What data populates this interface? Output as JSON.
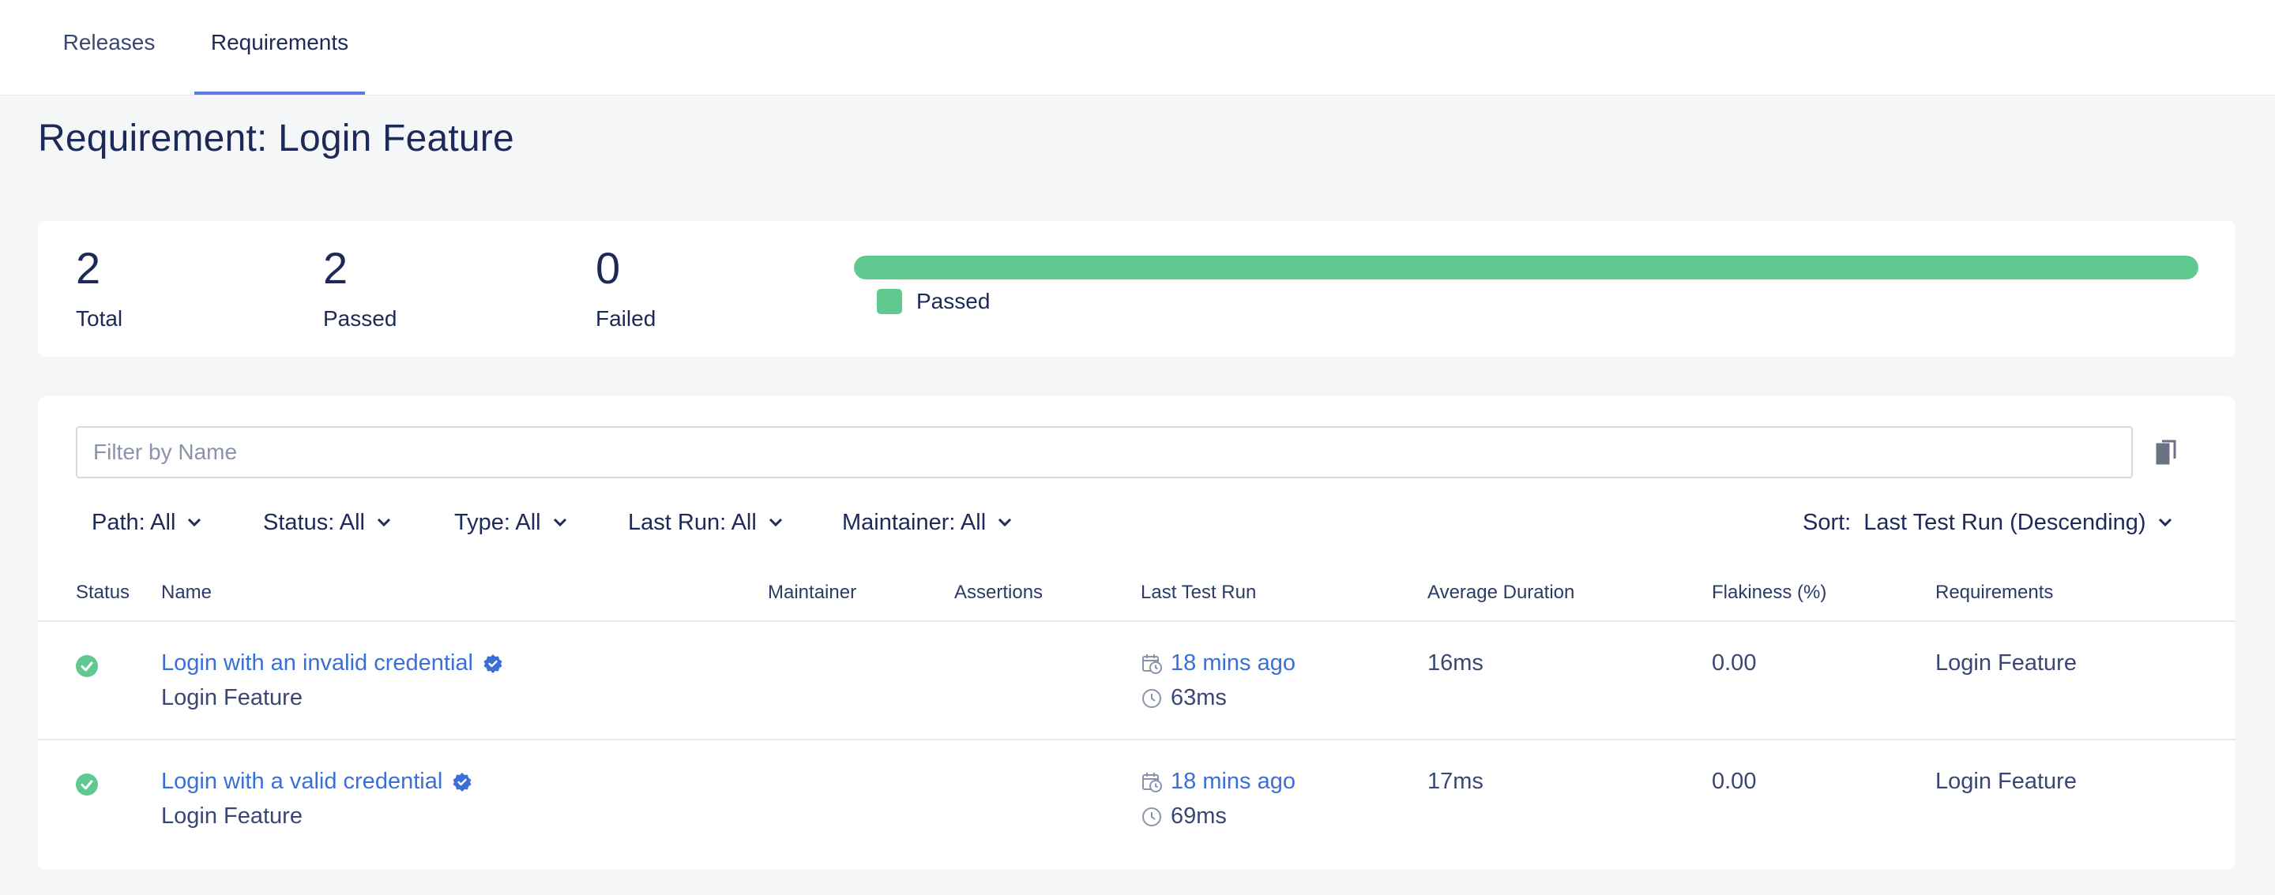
{
  "tabs": {
    "releases": "Releases",
    "requirements": "Requirements"
  },
  "page": {
    "title": "Requirement: Login Feature"
  },
  "summary": {
    "total_value": "2",
    "total_label": "Total",
    "passed_value": "2",
    "passed_label": "Passed",
    "failed_value": "0",
    "failed_label": "Failed",
    "pass_fraction": 1.0,
    "legend_passed": "Passed"
  },
  "colors": {
    "accent": "#5b7be0",
    "passed": "#5fc98f",
    "link": "#3b6fd8",
    "text": "#1d2a57"
  },
  "filter": {
    "placeholder": "Filter by Name",
    "value": ""
  },
  "filters": {
    "path": "Path: All",
    "status": "Status: All",
    "type": "Type: All",
    "last_run": "Last Run: All",
    "maintainer": "Maintainer: All",
    "sort_label": "Sort:",
    "sort_value": "Last Test Run (Descending)"
  },
  "table": {
    "headers": {
      "status": "Status",
      "name": "Name",
      "maintainer": "Maintainer",
      "assertions": "Assertions",
      "last_test_run": "Last Test Run",
      "average_duration": "Average Duration",
      "flakiness": "Flakiness (%)",
      "requirements": "Requirements"
    },
    "rows": [
      {
        "status": "passed",
        "name": "Login with an invalid credential",
        "requirement_sub": "Login Feature",
        "maintainer": "",
        "assertions": "",
        "last_run": "18 mins ago",
        "last_run_duration": "63ms",
        "average_duration": "16ms",
        "flakiness": "0.00",
        "requirements": "Login Feature"
      },
      {
        "status": "passed",
        "name": "Login with a valid credential",
        "requirement_sub": "Login Feature",
        "maintainer": "",
        "assertions": "",
        "last_run": "18 mins ago",
        "last_run_duration": "69ms",
        "average_duration": "17ms",
        "flakiness": "0.00",
        "requirements": "Login Feature"
      }
    ]
  },
  "icons": {
    "status_passed": "check-circle-icon",
    "test_badge": "verified-badge-icon",
    "calendar": "calendar-clock-icon",
    "clock": "clock-icon",
    "copy": "copy-icon",
    "chevron": "chevron-down-icon"
  }
}
